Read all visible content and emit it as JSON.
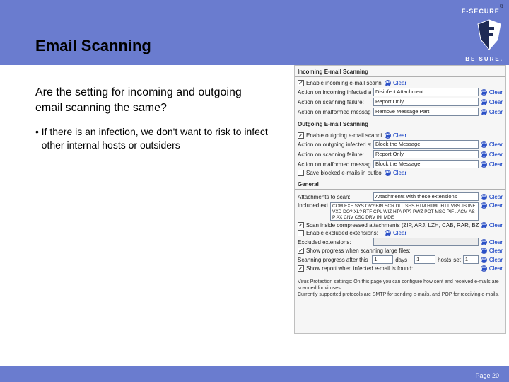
{
  "brand": {
    "name": "F-SECURE",
    "reg": "®",
    "slogan": "BE SURE."
  },
  "title": "Email Scanning",
  "question": "Are the setting for incoming and outgoing email scanning the same?",
  "bullet": "If there is an infection, we don't want to risk to infect other internal hosts or outsiders",
  "page_label": "Page 20",
  "in": {
    "heading": "Incoming E-mail Scanning",
    "enable_label": "Enable incoming e-mail scanning",
    "act_infected_label": "Action on incoming infected attachment:",
    "act_infected_value": "Disinfect Attachment",
    "act_fail_label": "Action on scanning failure:",
    "act_fail_value": "Report Only",
    "act_malformed_label": "Action on malformed message parts:",
    "act_malformed_value": "Remove Message Part",
    "clear": "Clear"
  },
  "out": {
    "heading": "Outgoing E-mail Scanning",
    "enable_label": "Enable outgoing e-mail scanning",
    "act_infected_label": "Action on outgoing infected attachment:",
    "act_infected_value": "Block the Message",
    "act_fail_label": "Action on scanning failure:",
    "act_fail_value": "Report Only",
    "act_malformed_label": "Action on malformed message parts:",
    "act_malformed_value": "Block the Message",
    "save_outbox_label": "Save blocked e-mails in outbox:",
    "clear": "Clear"
  },
  "gen": {
    "heading": "General",
    "attachments_label": "Attachments to scan:",
    "attachments_value": "Attachments with these extensions",
    "included_label": "Included extensions:",
    "included_value": "COM EXE SYS OV? BIN SCR DLL SHS HTM HTML HTT VBS JS INF VXD DO? XL? RTF CPL WIZ HTA PP? PWZ POT MSO PIF . ACM ASP AX CNV CSC DRV INI MDE",
    "scan_compressed_label": "Scan inside compressed attachments (ZIP, ARJ, LZH, CAB, RAR, BZ2, GZ, JAR, TAR, TGZ):",
    "enable_excluded_label": "Enable excluded extensions:",
    "excluded_label": "Excluded extensions:",
    "excluded_value": "",
    "progress_label": "Show progress when scanning large files:",
    "after_label": "Scanning progress after this many:",
    "after_days": "1",
    "after_days_unit": "days",
    "after_hosts": "1",
    "after_hosts_unit": "hosts",
    "after_last": "1",
    "report_label": "Show report when infected e-mail is found:",
    "clear": "Clear"
  },
  "notes": {
    "line1": "Virus Protection settings: On this page you can configure how sent and received e-mails are scanned for viruses.",
    "line2": "Currently supported protocols are SMTP for sending e-mails, and POP for receiving e-mails."
  }
}
